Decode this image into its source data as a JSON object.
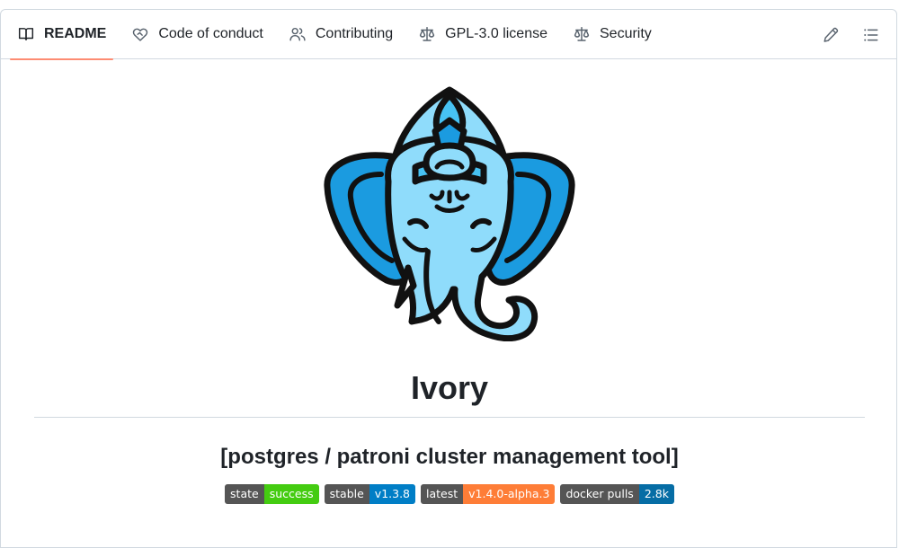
{
  "tabs": [
    {
      "label": "README",
      "icon": "book-icon",
      "active": true
    },
    {
      "label": "Code of conduct",
      "icon": "code-of-conduct-icon",
      "active": false
    },
    {
      "label": "Contributing",
      "icon": "people-icon",
      "active": false
    },
    {
      "label": "GPL-3.0 license",
      "icon": "law-icon",
      "active": false
    },
    {
      "label": "Security",
      "icon": "law-icon",
      "active": false
    }
  ],
  "actions": {
    "edit_icon": "pencil-icon",
    "outline_icon": "list-unordered-icon"
  },
  "readme": {
    "title": "Ivory",
    "subtitle": "[postgres / patroni cluster management tool]",
    "badges": [
      {
        "label": "state",
        "value": "success",
        "color": "#4c1"
      },
      {
        "label": "stable",
        "value": "v1.3.8",
        "color": "#007ec6"
      },
      {
        "label": "latest",
        "value": "v1.4.0-alpha.3",
        "color": "#fe7d37"
      },
      {
        "label": "docker pulls",
        "value": "2.8k",
        "color": "#066da5"
      }
    ]
  },
  "colors": {
    "active_tab_underline": "#fd8c73",
    "border": "#d1d9e0",
    "logo_light": "#8fdcfb",
    "logo_mid": "#47c2f3",
    "logo_dark": "#1b9be0"
  }
}
